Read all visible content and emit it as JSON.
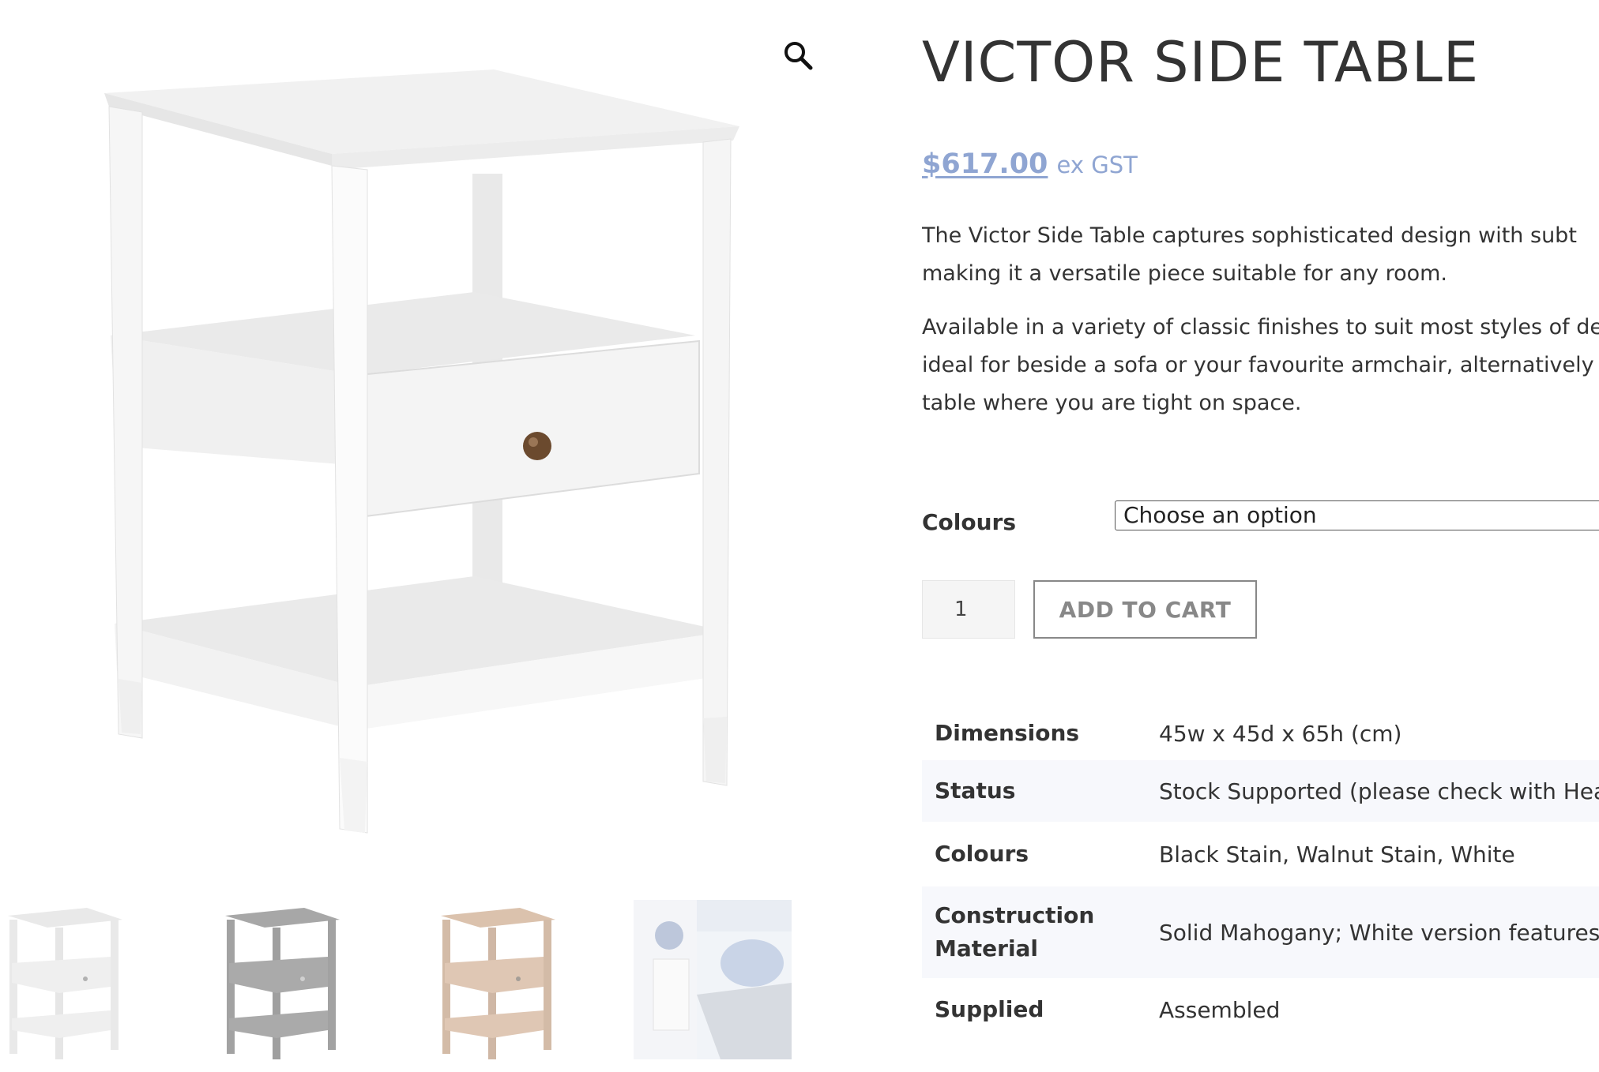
{
  "product": {
    "title": "VICTOR SIDE TABLE",
    "price": "$617.00",
    "price_suffix": "ex GST",
    "description": [
      "The Victor Side Table captures sophisticated design with subt",
      "making it a versatile piece suitable for any room.",
      "Available in a variety of classic finishes to suit most styles of de",
      "ideal for beside a sofa or your favourite armchair, alternatively",
      "table where you are tight on space."
    ]
  },
  "variation": {
    "label": "Colours",
    "selected": "Choose an option"
  },
  "cart": {
    "quantity": "1",
    "add_label": "ADD TO CART"
  },
  "attributes": [
    {
      "label": "Dimensions",
      "value": "45w x 45d x 65h (cm)"
    },
    {
      "label": "Status",
      "value": "Stock Supported (please check with Hea"
    },
    {
      "label": "Colours",
      "value": "Black Stain, Walnut Stain, White"
    },
    {
      "label": "Construction Material",
      "value": "Solid Mahogany; White version features"
    },
    {
      "label": "Supplied",
      "value": "Assembled"
    }
  ],
  "gallery": {
    "zoom_icon": "magnifier-icon",
    "thumbnails": [
      "white",
      "black-stain",
      "walnut-stain",
      "bedroom-lifestyle"
    ]
  },
  "colors": {
    "price": "#8fa5d2",
    "text": "#333333",
    "button_border": "#888888",
    "table_alt_row": "#f7f8fc"
  }
}
